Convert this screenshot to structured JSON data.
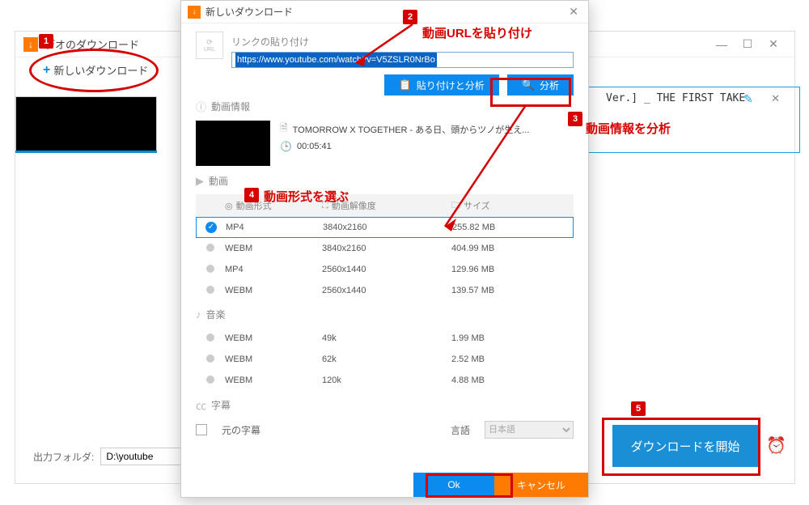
{
  "main": {
    "title": "デオのダウンロード",
    "new_download": "新しいダウンロード",
    "right_title": "Ver.]  _  THE FIRST TAKE",
    "output_label": "出力フォルダ:",
    "output_path": "D:\\youtube",
    "start_button": "ダウンロードを開始"
  },
  "dialog": {
    "title": "新しいダウンロード",
    "link_label": "リンクの貼り付け",
    "url": "https://www.youtube.com/watch?v=V5ZSLR0NrBo",
    "paste_analyze": "貼り付けと分析",
    "analyze": "分析",
    "info_label": "動画情報",
    "video_title": "TOMORROW X TOGETHER - ある日、頭からツノが生え...",
    "duration": "00:05:41",
    "video_section": "動画",
    "format_header": "動画形式",
    "resolution_header": "動画解像度",
    "size_header": "サイズ",
    "video_formats": [
      {
        "fmt": "MP4",
        "res": "3840x2160",
        "size": "255.82 MB",
        "selected": true
      },
      {
        "fmt": "WEBM",
        "res": "3840x2160",
        "size": "404.99 MB"
      },
      {
        "fmt": "MP4",
        "res": "2560x1440",
        "size": "129.96 MB"
      },
      {
        "fmt": "WEBM",
        "res": "2560x1440",
        "size": "139.57 MB"
      }
    ],
    "audio_section": "音楽",
    "audio_formats": [
      {
        "fmt": "WEBM",
        "res": "49k",
        "size": "1.99 MB"
      },
      {
        "fmt": "WEBM",
        "res": "62k",
        "size": "2.52 MB"
      },
      {
        "fmt": "WEBM",
        "res": "120k",
        "size": "4.88 MB"
      }
    ],
    "subtitle_label": "字幕",
    "orig_sub": "元の字幕",
    "lang_label": "言語",
    "lang_value": "日本語",
    "ok": "Ok",
    "cancel": "キャンセル"
  },
  "anno": {
    "t1": "動画URLを貼り付け",
    "t2": "動画情報を分析",
    "t3": "動画形式を選ぶ"
  }
}
